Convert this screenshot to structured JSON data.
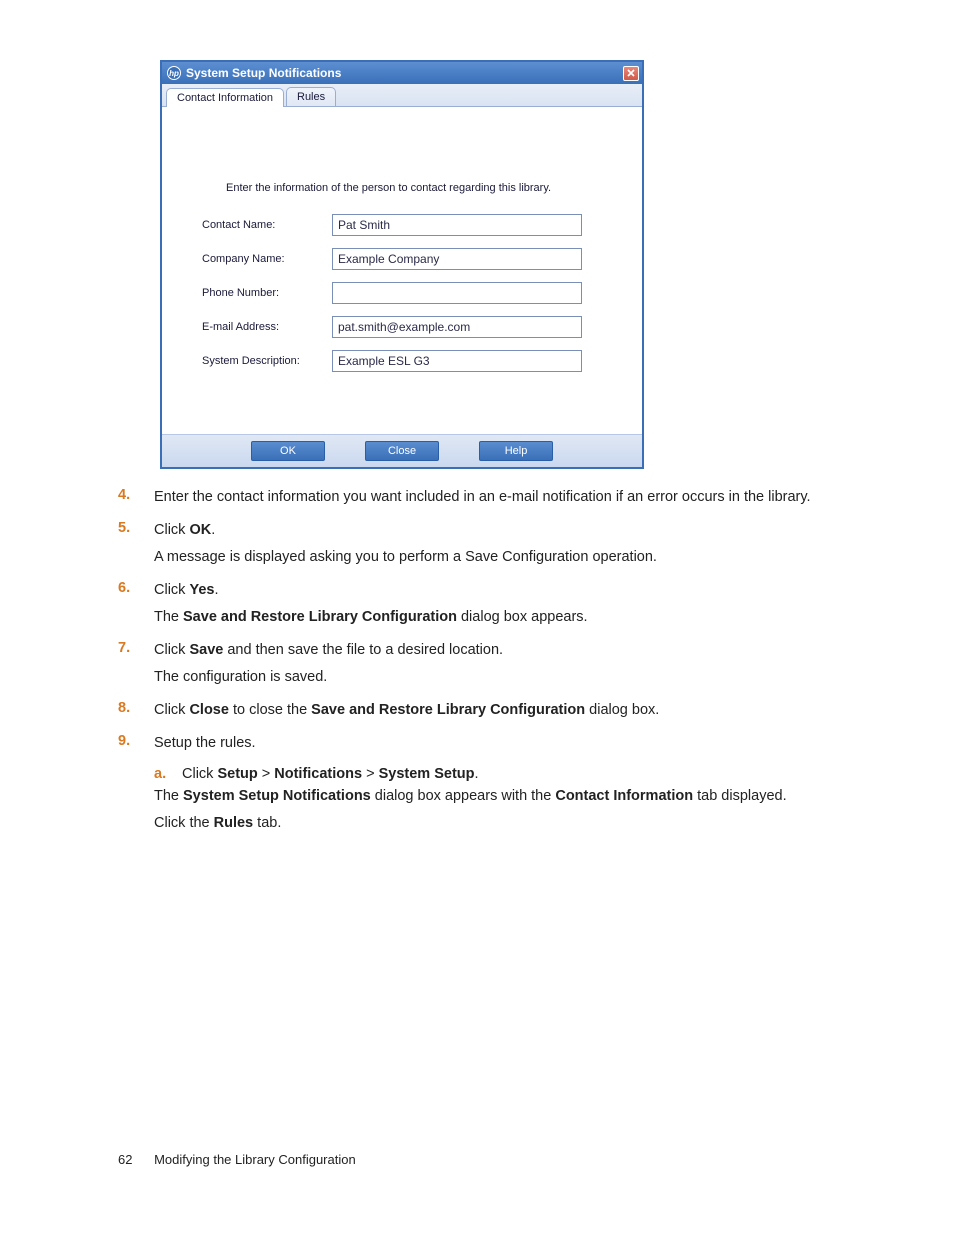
{
  "dialog": {
    "title": "System Setup Notifications",
    "tabs": {
      "contact": "Contact Information",
      "rules": "Rules"
    },
    "instruction": "Enter the information of the person to contact regarding this library.",
    "fields": {
      "contactName": {
        "label": "Contact Name:",
        "value": "Pat Smith"
      },
      "companyName": {
        "label": "Company Name:",
        "value": "Example Company"
      },
      "phone": {
        "label": "Phone Number:",
        "value": ""
      },
      "email": {
        "label": "E-mail Address:",
        "value": "pat.smith@example.com"
      },
      "sysdesc": {
        "label": "System Description:",
        "value": "Example ESL G3"
      }
    },
    "buttons": {
      "ok": "OK",
      "close": "Close",
      "help": "Help"
    }
  },
  "steps": {
    "s4": {
      "num": "4.",
      "p1a": "Enter the contact information you want included in an e-mail notification if an error occurs in the library."
    },
    "s5": {
      "num": "5.",
      "p1a": "Click ",
      "p1b": "OK",
      "p1c": ".",
      "p2": "A message is displayed asking you to perform a Save Configuration operation."
    },
    "s6": {
      "num": "6.",
      "p1a": "Click ",
      "p1b": "Yes",
      "p1c": ".",
      "p2a": "The ",
      "p2b": "Save and Restore Library Configuration",
      "p2c": " dialog box appears."
    },
    "s7": {
      "num": "7.",
      "p1a": "Click ",
      "p1b": "Save",
      "p1c": " and then save the file to a desired location.",
      "p2": "The configuration is saved."
    },
    "s8": {
      "num": "8.",
      "p1a": "Click ",
      "p1b": "Close",
      "p1c": " to close the ",
      "p1d": "Save and Restore Library Configuration",
      "p1e": " dialog box."
    },
    "s9": {
      "num": "9.",
      "p1": "Setup the rules.",
      "suba": {
        "num": "a.",
        "t1": "Click ",
        "t2": "Setup",
        "t3": " > ",
        "t4": "Notifications",
        "t5": " > ",
        "t6": "System Setup",
        "t7": "."
      },
      "p2a": "The ",
      "p2b": "System Setup Notifications",
      "p2c": " dialog box appears with the ",
      "p2d": "Contact Information",
      "p2e": " tab displayed.",
      "p3a": "Click the ",
      "p3b": "Rules",
      "p3c": " tab."
    }
  },
  "footer": {
    "page": "62",
    "title": "Modifying the Library Configuration"
  }
}
